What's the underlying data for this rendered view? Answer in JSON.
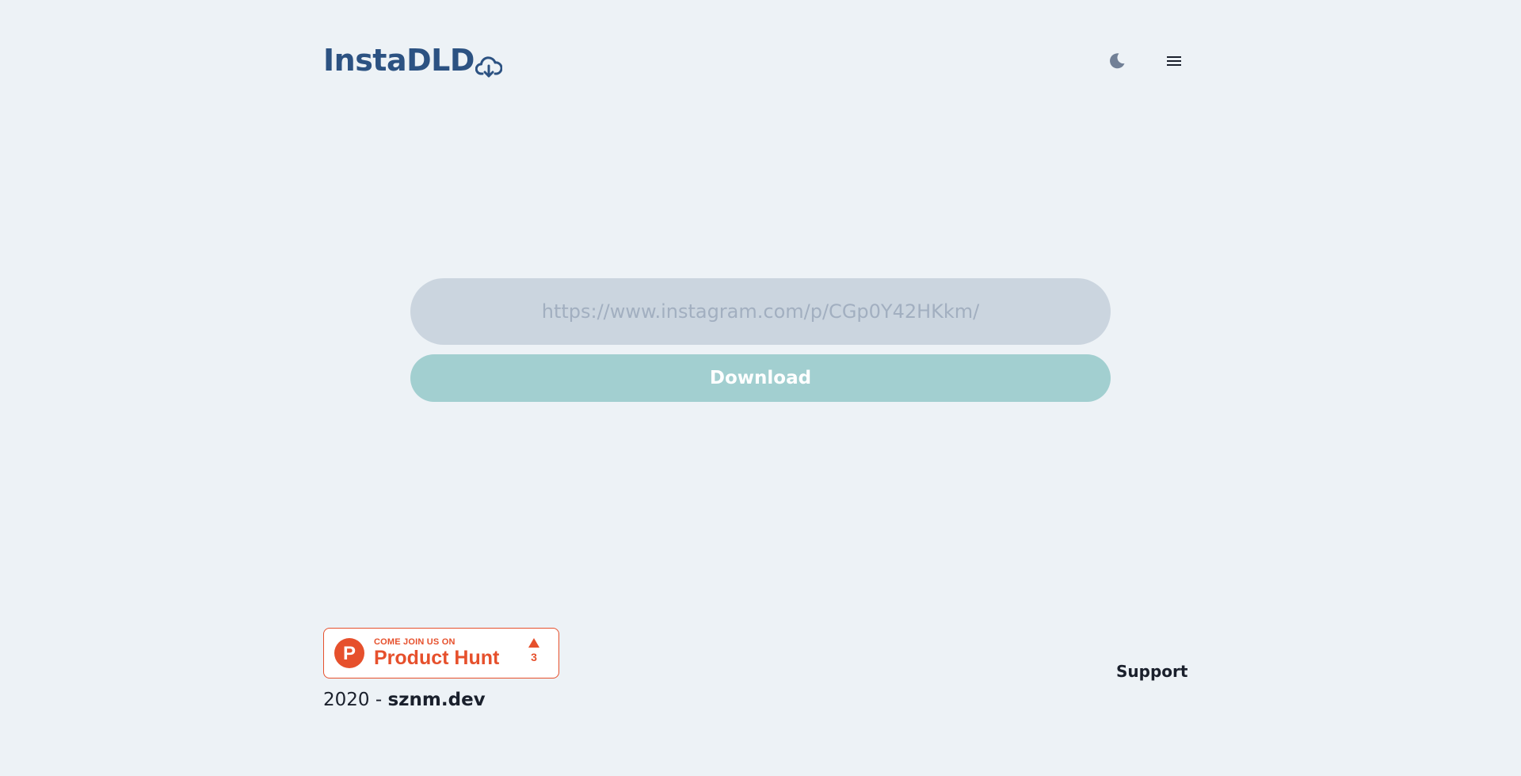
{
  "header": {
    "logo_text": "InstaDLD",
    "logo_icon": "cloud-download-icon",
    "theme_toggle_icon": "moon-icon",
    "menu_icon": "hamburger-menu-icon"
  },
  "form": {
    "url_placeholder": "https://www.instagram.com/p/CGp0Y42HKkm/",
    "url_value": "",
    "download_label": "Download"
  },
  "footer": {
    "product_hunt": {
      "small_text": "COME JOIN US ON",
      "big_text": "Product Hunt",
      "logo_letter": "P",
      "votes": "3"
    },
    "copyright_year": "2020",
    "copyright_separator": " - ",
    "copyright_site": "sznm.dev",
    "support_label": "Support"
  },
  "colors": {
    "background": "#edf2f6",
    "brand": "#2c5282",
    "input_bg": "#cbd5df",
    "button_bg": "#a2cfd0",
    "product_hunt": "#e6502c"
  }
}
